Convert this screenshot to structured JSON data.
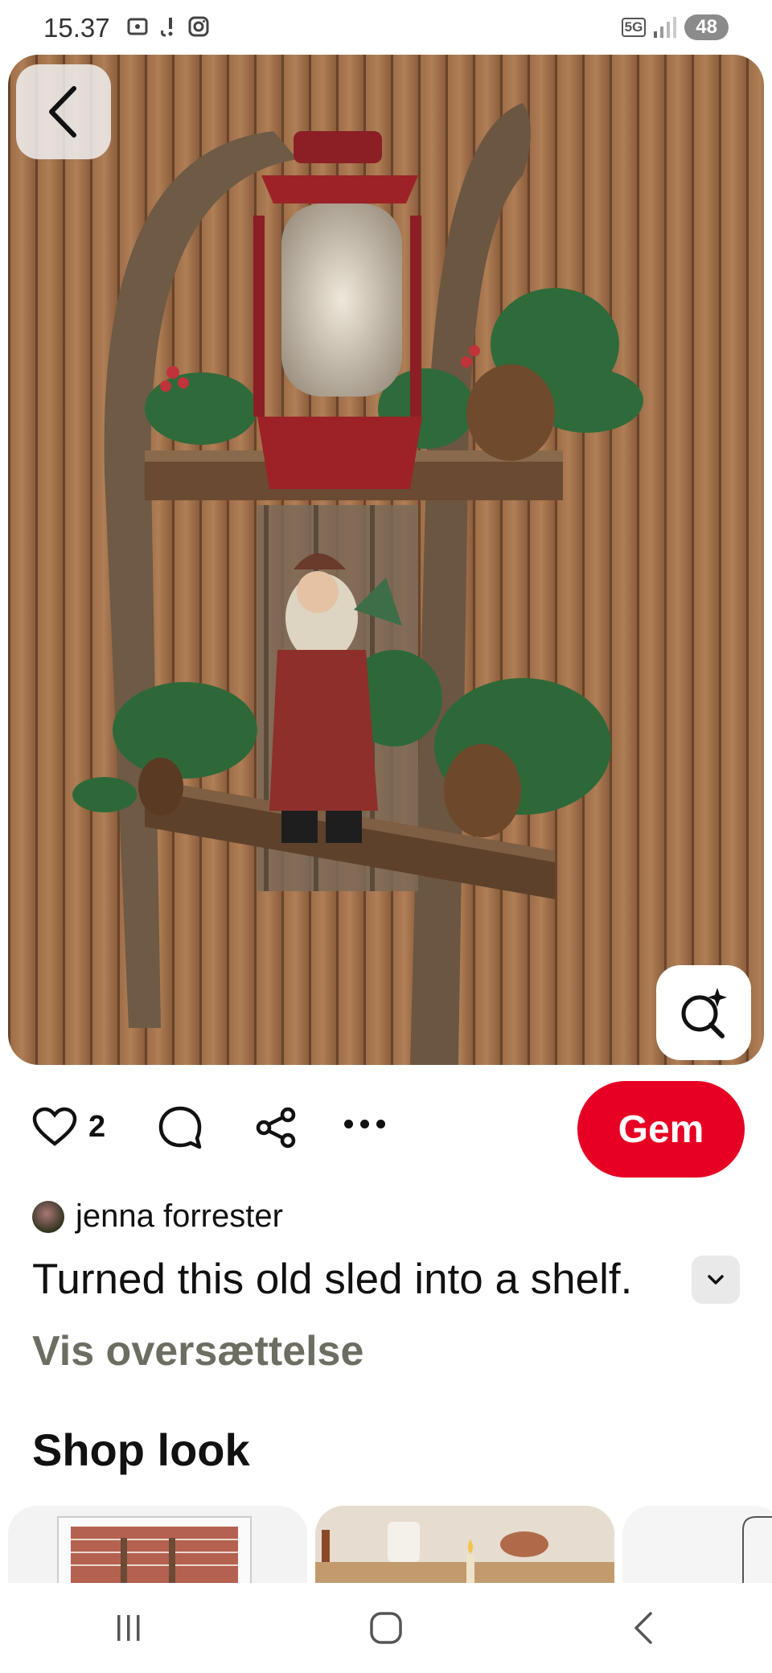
{
  "status_bar": {
    "time": "15.37",
    "network": "5G",
    "battery": "48"
  },
  "pin": {
    "like_count": "2",
    "save_label": "Gem",
    "author_name": "jenna forrester",
    "description": "Turned this old sled into a shelf.",
    "translate_label": "Vis oversættelse"
  },
  "shop": {
    "title": "Shop look"
  },
  "colors": {
    "brand_red": "#e60023",
    "translate_text": "#6d6d62"
  },
  "icons": {
    "back": "chevron-left-icon",
    "visual_search": "lens-sparkle-icon",
    "like": "heart-outline-icon",
    "comment": "speech-bubble-icon",
    "share": "share-nodes-icon",
    "more": "more-dots-icon",
    "expand": "chevron-down-icon"
  }
}
